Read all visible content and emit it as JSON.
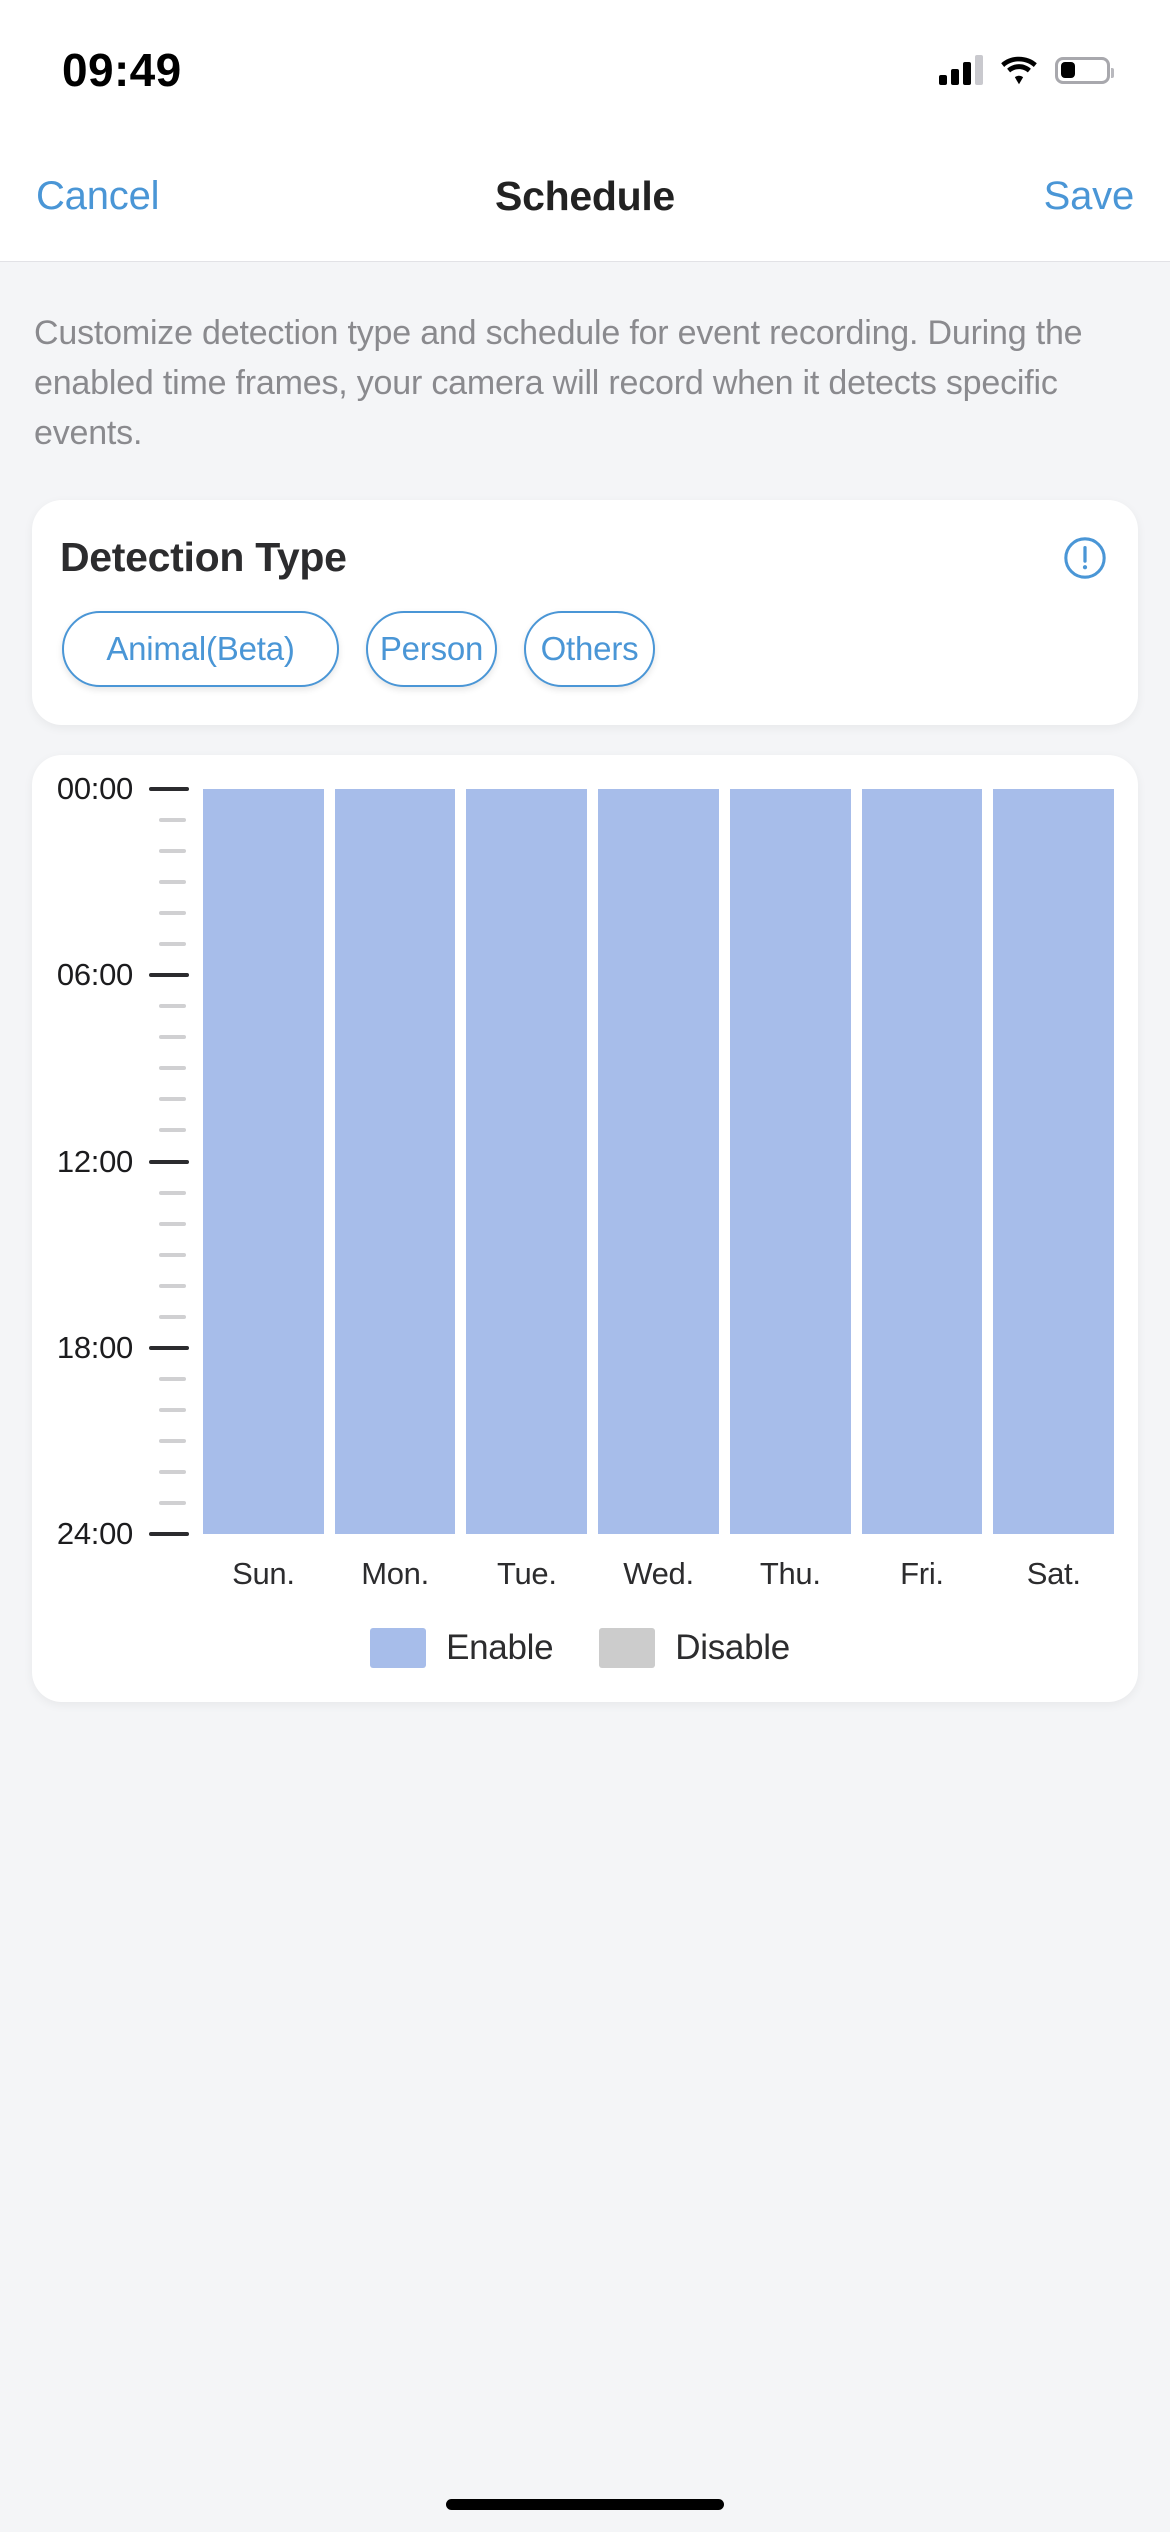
{
  "status_bar": {
    "time": "09:49",
    "cellular_icon": "cellular-signal-icon",
    "wifi_icon": "wifi-icon",
    "battery_icon": "battery-icon",
    "battery_level_percent": 32
  },
  "nav": {
    "cancel_label": "Cancel",
    "title": "Schedule",
    "save_label": "Save",
    "accent_color": "#4a96d6"
  },
  "description": "Customize detection type and schedule for event recording. During the enabled time frames, your camera will record when it detects specific events.",
  "detection_card": {
    "title": "Detection Type",
    "info_icon": "info-exclamation-circle-icon",
    "options": [
      {
        "label": "Animal(Beta)",
        "selected": true
      },
      {
        "label": "Person",
        "selected": true
      },
      {
        "label": "Others",
        "selected": true
      }
    ]
  },
  "legend": [
    {
      "label": "Enable",
      "color": "#a7bdea"
    },
    {
      "label": "Disable",
      "color": "#cccccc"
    }
  ],
  "chart_data": {
    "type": "bar",
    "title": "",
    "xlabel": "",
    "ylabel": "",
    "categories": [
      "Sun.",
      "Mon.",
      "Tue.",
      "Wed.",
      "Thu.",
      "Fri.",
      "Sat."
    ],
    "ytick_labels": [
      "00:00",
      "06:00",
      "12:00",
      "18:00",
      "24:00"
    ],
    "ytick_values": [
      0,
      6,
      12,
      18,
      24
    ],
    "minor_tick_interval_hours": 1,
    "ylim": [
      0,
      24
    ],
    "y_inverted": true,
    "grid": false,
    "legend_position": "bottom-center",
    "series": [
      {
        "name": "Enable",
        "color": "#a7bdea",
        "values": [
          24,
          24,
          24,
          24,
          24,
          24,
          24
        ],
        "segments": [
          {
            "day": "Sun.",
            "start": "00:00",
            "end": "24:00",
            "state": "Enable"
          },
          {
            "day": "Mon.",
            "start": "00:00",
            "end": "24:00",
            "state": "Enable"
          },
          {
            "day": "Tue.",
            "start": "00:00",
            "end": "24:00",
            "state": "Enable"
          },
          {
            "day": "Wed.",
            "start": "00:00",
            "end": "24:00",
            "state": "Enable"
          },
          {
            "day": "Thu.",
            "start": "00:00",
            "end": "24:00",
            "state": "Enable"
          },
          {
            "day": "Fri.",
            "start": "00:00",
            "end": "24:00",
            "state": "Enable"
          },
          {
            "day": "Sat.",
            "start": "00:00",
            "end": "24:00",
            "state": "Enable"
          }
        ]
      },
      {
        "name": "Disable",
        "color": "#cccccc",
        "values": [
          0,
          0,
          0,
          0,
          0,
          0,
          0
        ]
      }
    ]
  }
}
